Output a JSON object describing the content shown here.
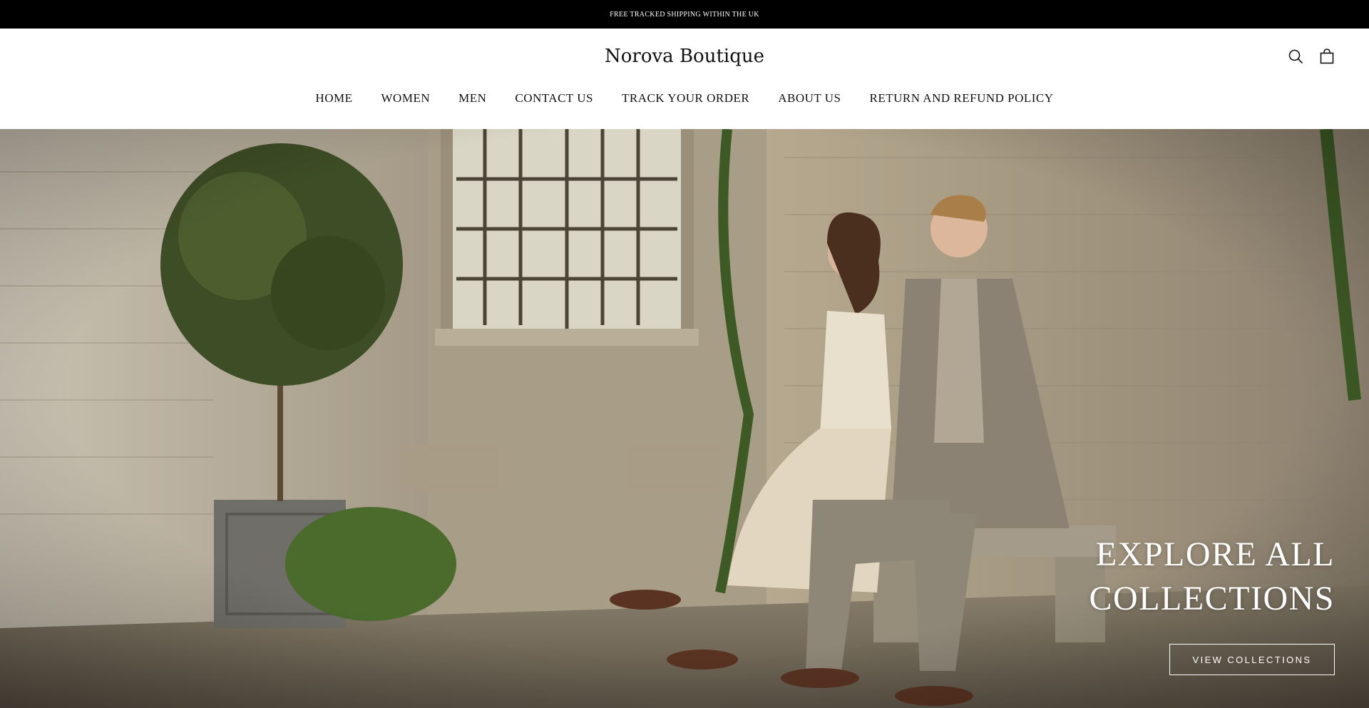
{
  "announcement": {
    "text": "FREE TRACKED SHIPPING WITHIN THE UK"
  },
  "header": {
    "logo": "Norova Boutique",
    "icons": [
      "search-icon",
      "shopping-bag-icon"
    ]
  },
  "nav": {
    "items": [
      {
        "label": "HOME"
      },
      {
        "label": "WOMEN"
      },
      {
        "label": "MEN"
      },
      {
        "label": "CONTACT US"
      },
      {
        "label": "TRACK YOUR ORDER"
      },
      {
        "label": "ABOUT US"
      },
      {
        "label": "RETURN AND REFUND POLICY"
      }
    ]
  },
  "hero": {
    "heading_line1": "EXPLORE ALL",
    "heading_line2": "COLLECTIONS",
    "cta_label": "VIEW COLLECTIONS"
  },
  "colors": {
    "announcement_bg": "#000000",
    "header_bg": "#ffffff",
    "text": "#111111",
    "hero_text": "#ffffff"
  }
}
